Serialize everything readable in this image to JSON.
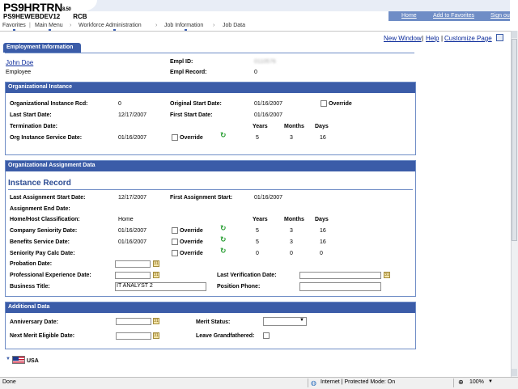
{
  "header": {
    "app_title": "PS9HRTRN",
    "version": "8.50",
    "server": "PS9HEWEBDEV12",
    "db": "RCB",
    "links": [
      "Home",
      "Add to Favorites",
      "Sign out"
    ]
  },
  "nav": [
    "Favorites",
    "Main Menu",
    "Workforce Administration",
    "Job Information",
    "Job Data"
  ],
  "page_links": {
    "new_window": "New Window",
    "help": "Help",
    "customize": "Customize Page",
    "sep": "|"
  },
  "tab": "Employment Information",
  "employee": {
    "name": "John Doe",
    "type": "Employee",
    "empl_id_label": "Empl ID:",
    "empl_id_value": "0110576",
    "empl_record_label": "Empl Record:",
    "empl_record_value": "0"
  },
  "org_instance": {
    "title": "Organizational Instance",
    "rcd_label": "Organizational Instance Rcd:",
    "rcd_value": "0",
    "orig_start_label": "Original Start Date:",
    "orig_start_value": "01/16/2007",
    "override_label": "Override",
    "last_start_label": "Last Start Date:",
    "last_start_value": "12/17/2007",
    "first_start_label": "First Start Date:",
    "first_start_value": "01/16/2007",
    "term_label": "Termination Date:",
    "years": "Years",
    "months": "Months",
    "days": "Days",
    "service_label": "Org Instance Service Date:",
    "service_value": "01/16/2007",
    "service_years": "5",
    "service_months": "3",
    "service_days": "16"
  },
  "assignment": {
    "title": "Organizational Assignment Data",
    "subtitle": "Instance Record",
    "last_assign_label": "Last Assignment Start Date:",
    "last_assign_value": "12/17/2007",
    "first_assign_label": "First Assignment Start:",
    "first_assign_value": "01/16/2007",
    "end_label": "Assignment End Date:",
    "home_host_label": "Home/Host Classification:",
    "home_host_value": "Home",
    "company_seniority_label": "Company Seniority Date:",
    "company_seniority_value": "01/16/2007",
    "company_y": "5",
    "company_m": "3",
    "company_d": "16",
    "benefits_label": "Benefits Service Date:",
    "benefits_value": "01/16/2007",
    "benefits_y": "5",
    "benefits_m": "3",
    "benefits_d": "16",
    "seniority_calc_label": "Seniority Pay Calc Date:",
    "seniority_y": "0",
    "seniority_m": "0",
    "seniority_d": "0",
    "probation_label": "Probation Date:",
    "prof_exp_label": "Professional Experience Date:",
    "last_verif_label": "Last Verification Date:",
    "business_title_label": "Business Title:",
    "business_title_value": "IT ANALYST 2",
    "position_phone_label": "Position Phone:"
  },
  "additional": {
    "title": "Additional Data",
    "anniversary_label": "Anniversary Date:",
    "merit_status_label": "Merit Status:",
    "next_merit_label": "Next Merit Eligible Date:",
    "leave_label": "Leave Grandfathered:"
  },
  "country": "USA",
  "status": {
    "left": "Done",
    "zone": "Internet | Protected Mode: On",
    "zoom": "100%"
  }
}
